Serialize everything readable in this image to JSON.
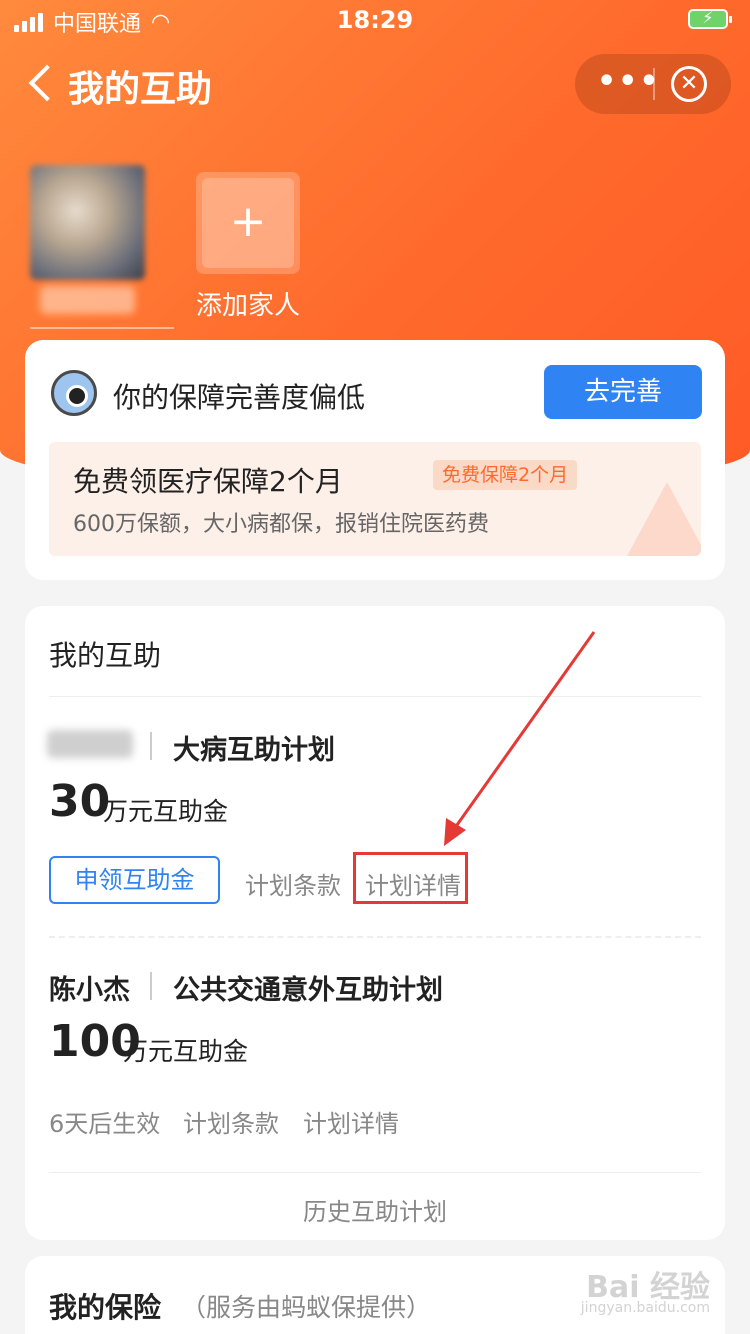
{
  "status_bar": {
    "carrier": "中国联通",
    "time": "18:29",
    "wifi_icon": "wifi-icon",
    "battery_icon": "battery-charging-icon"
  },
  "nav": {
    "title": "我的互助",
    "more_label": "•••",
    "close_label": "✕"
  },
  "family": {
    "add_label": "添加家人",
    "add_symbol": "+"
  },
  "coverage_card": {
    "title": "你的保障完善度偏低",
    "button": "去完善",
    "promo": {
      "title": "免费领医疗保障2个月",
      "badge": "免费保障2个月",
      "subtitle": "600万保额，大小病都保，报销住院医药费"
    }
  },
  "mutual_card": {
    "title": "我的互助",
    "plans": [
      {
        "owner": "",
        "name": "大病互助计划",
        "amount": "30",
        "unit": "万元互助金",
        "claim_button": "申领互助金",
        "terms": "计划条款",
        "details": "计划详情"
      },
      {
        "owner": "陈小杰",
        "name": "公共交通意外互助计划",
        "amount": "100",
        "unit": "万元互助金",
        "status": "6天后生效",
        "terms": "计划条款",
        "details": "计划详情"
      }
    ],
    "history": "历史互助计划"
  },
  "insurance_card": {
    "title": "我的保险",
    "subtitle": "（服务由蚂蚁保提供）"
  },
  "watermark": {
    "text": "Bai 经验",
    "sub": "jingyan.baidu.com"
  },
  "colors": {
    "primary": "#2f83f2",
    "hero": "#ff6a2c",
    "annotation": "#e53935"
  }
}
